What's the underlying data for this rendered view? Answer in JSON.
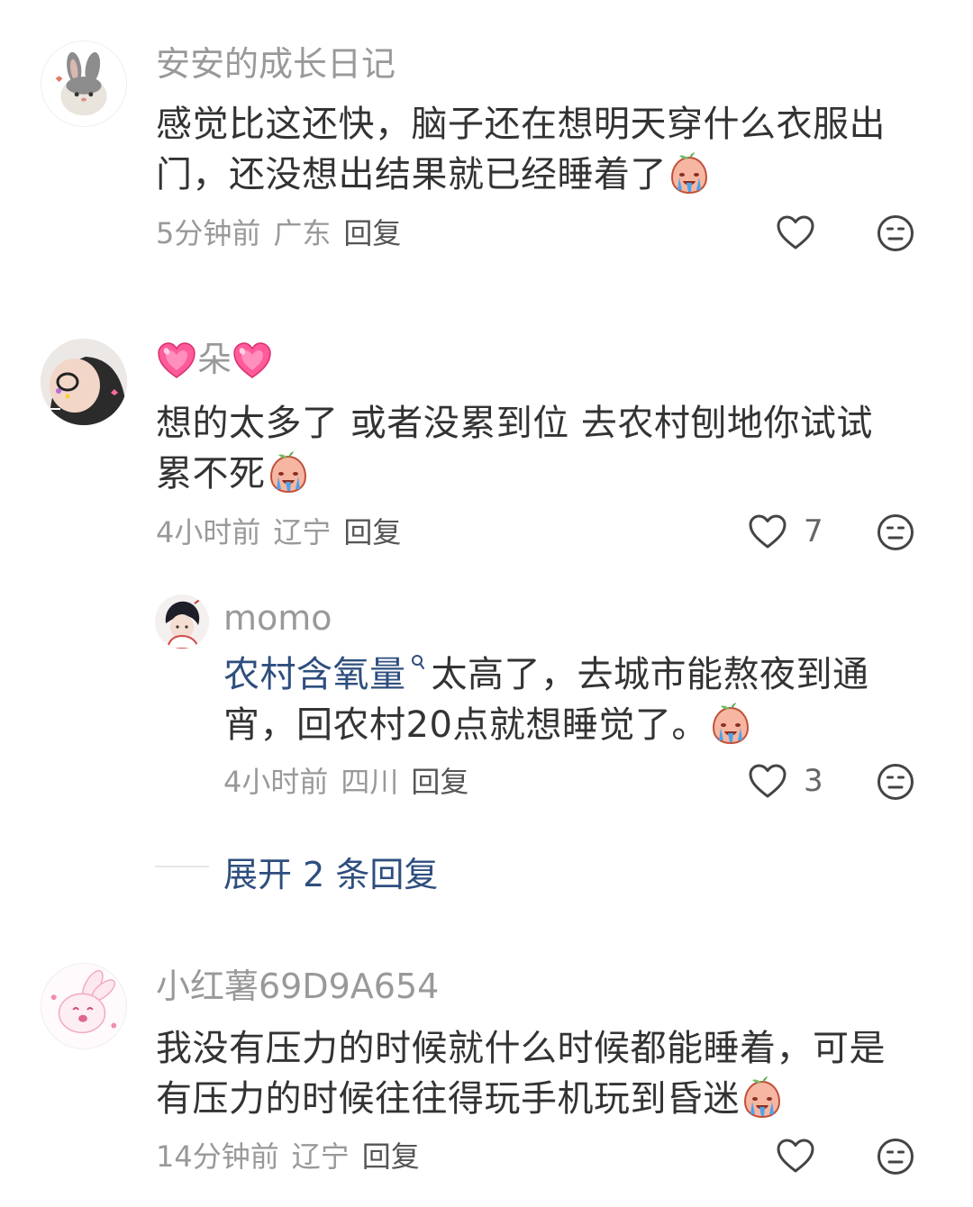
{
  "comments": [
    {
      "username": "安安的成长日记",
      "text": "感觉比这还快，脑子还在想明天穿什么衣服出门，还没想出结果就已经睡着了",
      "time": "5分钟前",
      "location": "广东",
      "reply_label": "回复",
      "like_count": ""
    },
    {
      "username": "朵",
      "text": "想的太多了 或者没累到位 去农村刨地你试试累不死",
      "time": "4小时前",
      "location": "辽宁",
      "reply_label": "回复",
      "like_count": "7",
      "reply": {
        "username": "momo",
        "link_text": "农村含氧量",
        "text": "太高了，去城市能熬夜到通宵，回农村20点就想睡觉了。",
        "time": "4小时前",
        "location": "四川",
        "reply_label": "回复",
        "like_count": "3"
      },
      "expand_label": "展开 2 条回复"
    },
    {
      "username": "小红薯69D9A654",
      "text": "我没有压力的时候就什么时候都能睡着，可是有压力的时候往往得玩手机玩到昏迷",
      "time": "14分钟前",
      "location": "辽宁",
      "reply_label": "回复",
      "like_count": ""
    }
  ],
  "icons": {
    "like": "heart-outline-icon",
    "dislike": "neutral-face-icon",
    "emoji": "crying-peach-emoji",
    "search_mark": "search-icon"
  },
  "colors": {
    "text": "#333333",
    "meta": "#999999",
    "link": "#2e4e7e"
  }
}
